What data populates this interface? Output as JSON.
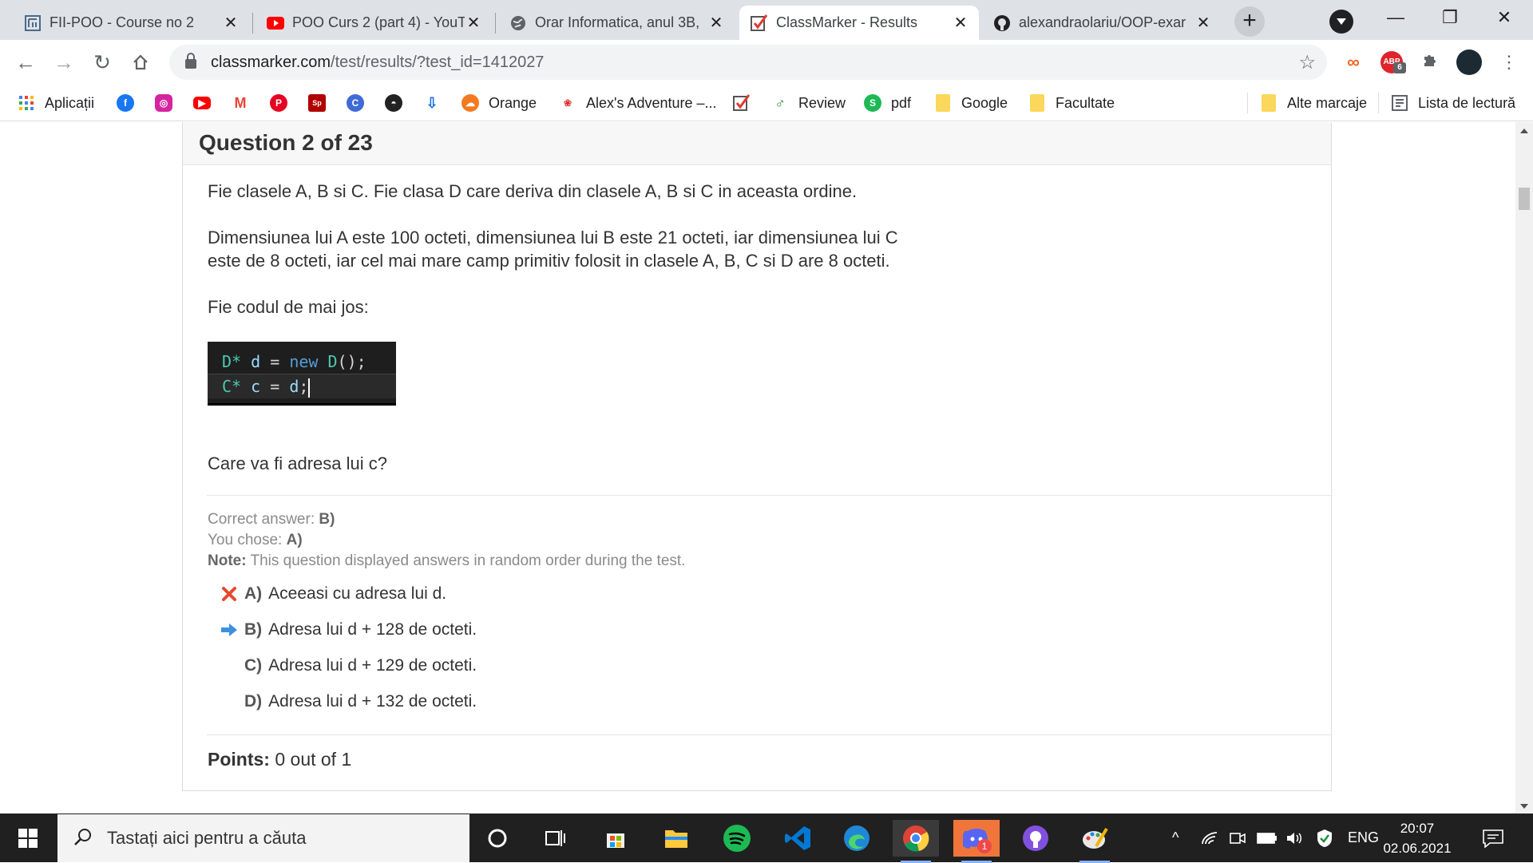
{
  "browser": {
    "tabs": [
      {
        "title": "FII-POO - Course no 2",
        "icon": "fii-icon"
      },
      {
        "title": "POO Curs 2 (part 4) - YouT",
        "icon": "youtube-icon"
      },
      {
        "title": "Orar Informatica, anul 3B,",
        "icon": "globe-icon"
      },
      {
        "title": "ClassMarker - Results",
        "icon": "classmarker-icon"
      },
      {
        "title": "alexandraolariu/OOP-exar",
        "icon": "github-icon"
      }
    ],
    "new_tab": "+",
    "url_host": "classmarker.com",
    "url_path": "/test/results/?test_id=1412027",
    "extension_badge": "6",
    "window": {
      "minimize": "—",
      "restore": "❐",
      "close": "✕"
    }
  },
  "bookmarks": {
    "apps": "Aplicații",
    "orange": "Orange",
    "alex": "Alex's Adventure –...",
    "review": "Review",
    "pdf": "pdf",
    "google": "Google",
    "facultate": "Facultate",
    "other": "Alte marcaje",
    "reading": "Lista de lectură"
  },
  "question": {
    "header": "Question 2 of 23",
    "p1": "Fie clasele A, B si C. Fie clasa D care deriva din clasele A, B si C in aceasta ordine.",
    "p2a": "Dimensiunea lui A este 100 octeti, dimensiunea lui B este 21 octeti, iar dimensiunea lui C",
    "p2b": "este de 8 octeti, iar cel mai mare camp primitiv folosit in clasele A, B, C si D are 8 octeti.",
    "p3": "Fie codul de mai jos:",
    "code_line1": "D* d = new D();",
    "code_line2": "C* c = d;",
    "ask": "Care va fi adresa lui c?"
  },
  "result": {
    "correct_label": "Correct answer:",
    "correct_value": "B)",
    "chose_label": "You chose:",
    "chose_value": "A)",
    "note_label": "Note:",
    "note_text": "This question displayed answers in random order during the test.",
    "answers": [
      {
        "letter": "A)",
        "text": "Aceeasi cu adresa lui d.",
        "mark": "wrong"
      },
      {
        "letter": "B)",
        "text": "Adresa lui d + 128 de octeti.",
        "mark": "correct"
      },
      {
        "letter": "C)",
        "text": "Adresa lui d + 129 de octeti.",
        "mark": "none"
      },
      {
        "letter": "D)",
        "text": "Adresa lui d + 132 de octeti.",
        "mark": "none"
      }
    ],
    "points_label": "Points:",
    "points_value": "0 out of 1"
  },
  "taskbar": {
    "search_placeholder": "Tastați aici pentru a căuta",
    "language": "ENG",
    "time": "20:07",
    "date": "02.06.2021",
    "discord_badge": "1"
  },
  "colors": {
    "wrong": "#e8472c",
    "correct": "#3d8fe0",
    "taskbar": "#202020"
  }
}
